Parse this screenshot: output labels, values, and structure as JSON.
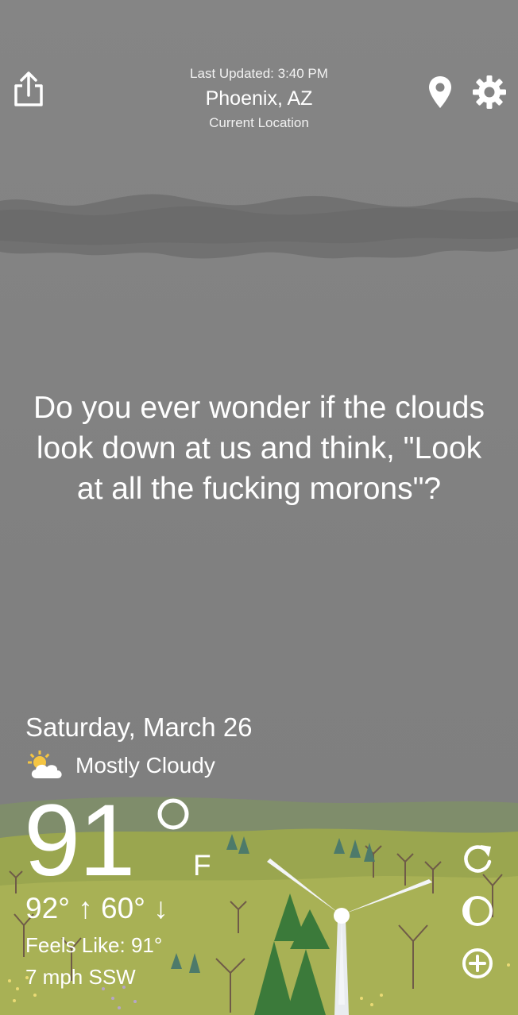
{
  "header": {
    "last_updated": "Last Updated: 3:40 PM",
    "location": "Phoenix, AZ",
    "location_source": "Current Location"
  },
  "quote": "Do you ever wonder if the clouds look down at us and think, \"Look at all the fucking morons\"?",
  "forecast": {
    "date": "Saturday, March 26",
    "condition": "Mostly Cloudy",
    "condition_icon": "partly-cloudy-icon",
    "temperature": "91",
    "unit": "F",
    "high_low": "92° ↑  60° ↓",
    "feels_like": "Feels Like: 91°",
    "wind": "7 mph SSW"
  },
  "icons": {
    "share": "share-icon",
    "location": "location-pin-icon",
    "settings": "gear-icon",
    "refresh": "refresh-icon",
    "moon": "moon-phase-icon",
    "add": "add-icon"
  },
  "colors": {
    "sky": "#848484",
    "cloud_band": "#6f6f6f",
    "grass": "#a3ae4e",
    "tree_green": "#3f7f3b",
    "text": "#ffffff"
  }
}
